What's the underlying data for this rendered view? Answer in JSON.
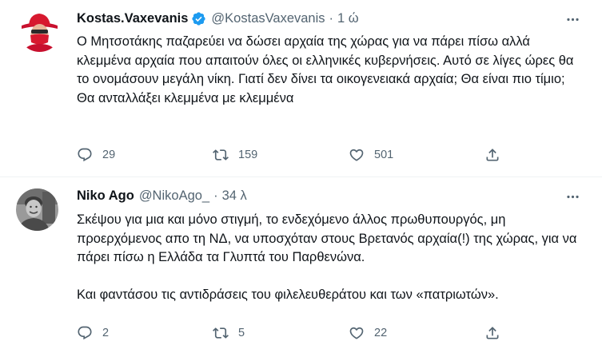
{
  "tweets": [
    {
      "author_name": "Kostas.Vaxevanis",
      "verified": true,
      "handle": "@KostasVaxevanis",
      "separator": "·",
      "time": "1 ώ",
      "text": "Ο Μητσοτάκης παζαρεύει να δώσει αρχαία της χώρας για να πάρει πίσω αλλά  κλεμμένα αρχαία που απαιτούν όλες οι ελληνικές κυβερνήσεις. Αυτό σε λίγες ώρες θα το ονομάσουν μεγάλη νίκη. Γιατί δεν δίνει τα οικογενειακά αρχαία; Θα είναι πιο τίμιο; Θα ανταλλάξει κλεμμένα με κλεμμένα",
      "replies": "29",
      "retweets": "159",
      "likes": "501",
      "share": ""
    },
    {
      "author_name": "Niko Ago",
      "verified": false,
      "handle": "@NikoAgo_",
      "separator": "·",
      "time": "34 λ",
      "text": "Σκέψου για μια και μόνο στιγμή, το ενδεχόμενο άλλος πρωθυπουργός, μη προερχόμενος απο τη ΝΔ, να υποσχόταν στους Βρετανός αρχαία(!) της χώρας, για να πάρει πίσω η Ελλάδα τα Γλυπτά του Παρθενώνα.\n\nΚαι φαντάσου τις αντιδράσεις του φιλελευθεράτου και των «πατριωτών».",
      "replies": "2",
      "retweets": "5",
      "likes": "22",
      "share": ""
    }
  ],
  "colors": {
    "text": "#0f1419",
    "secondary": "#536471",
    "verified_blue": "#1d9bf0",
    "divider": "#eff3f4"
  },
  "icons": [
    "avatar",
    "verified-badge-icon",
    "more-options-icon",
    "reply-icon",
    "retweet-icon",
    "like-icon",
    "share-icon"
  ]
}
